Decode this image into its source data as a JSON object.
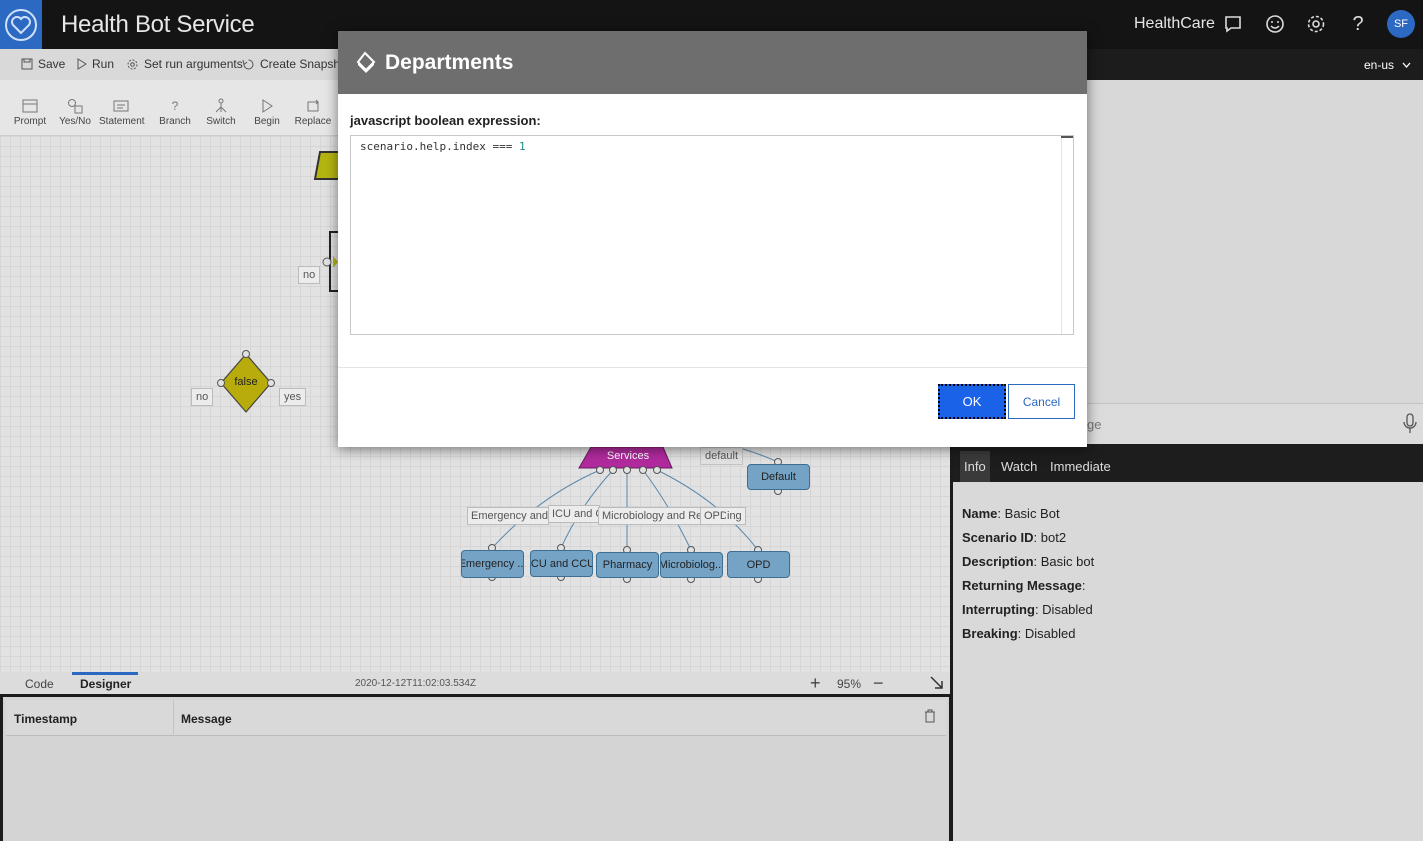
{
  "header": {
    "app_title": "Health Bot Service",
    "tenant": "HealthCare",
    "avatar_initials": "SF"
  },
  "toolbar": {
    "save": "Save",
    "run": "Run",
    "set_run_arguments": "Set run arguments",
    "create_snapshot": "Create Snapshot",
    "language": "en-us"
  },
  "palette": [
    "Prompt",
    "Yes/No",
    "Statement",
    "Branch",
    "Switch",
    "Begin",
    "Replace"
  ],
  "canvas": {
    "label_no_1": "no",
    "label_no_2": "no",
    "label_yes": "yes",
    "decision_text": "false",
    "services_text": "Services",
    "default_edge": "default",
    "default_node": "Default",
    "edge_labels": [
      "Emergency and Tr",
      "ICU and C",
      "Microbiology and Rese",
      "OPD",
      "ing"
    ],
    "nodes": [
      "Emergency ...",
      "ICU and CCU",
      "Pharmacy",
      "Microbiolog...",
      "OPD"
    ]
  },
  "bottom": {
    "tab_code": "Code",
    "tab_designer": "Designer",
    "timestamp": "2020-12-12T11:02:03.534Z",
    "zoom": "95%"
  },
  "log": {
    "col_timestamp": "Timestamp",
    "col_message": "Message"
  },
  "right": {
    "input_fragment": "ge",
    "tabs": [
      "Info",
      "Watch",
      "Immediate"
    ],
    "info": {
      "name_label": "Name",
      "name_value": "Basic Bot",
      "scenario_label": "Scenario ID",
      "scenario_value": "bot2",
      "description_label": "Description",
      "description_value": "Basic bot",
      "returning_label": "Returning Message",
      "returning_value": "",
      "interrupting_label": "Interrupting",
      "interrupting_value": "Disabled",
      "breaking_label": "Breaking",
      "breaking_value": "Disabled"
    }
  },
  "modal": {
    "title": "Departments",
    "expression_label": "javascript boolean expression:",
    "code_prefix": "scenario.help.index === ",
    "code_number": "1",
    "ok": "OK",
    "cancel": "Cancel"
  }
}
